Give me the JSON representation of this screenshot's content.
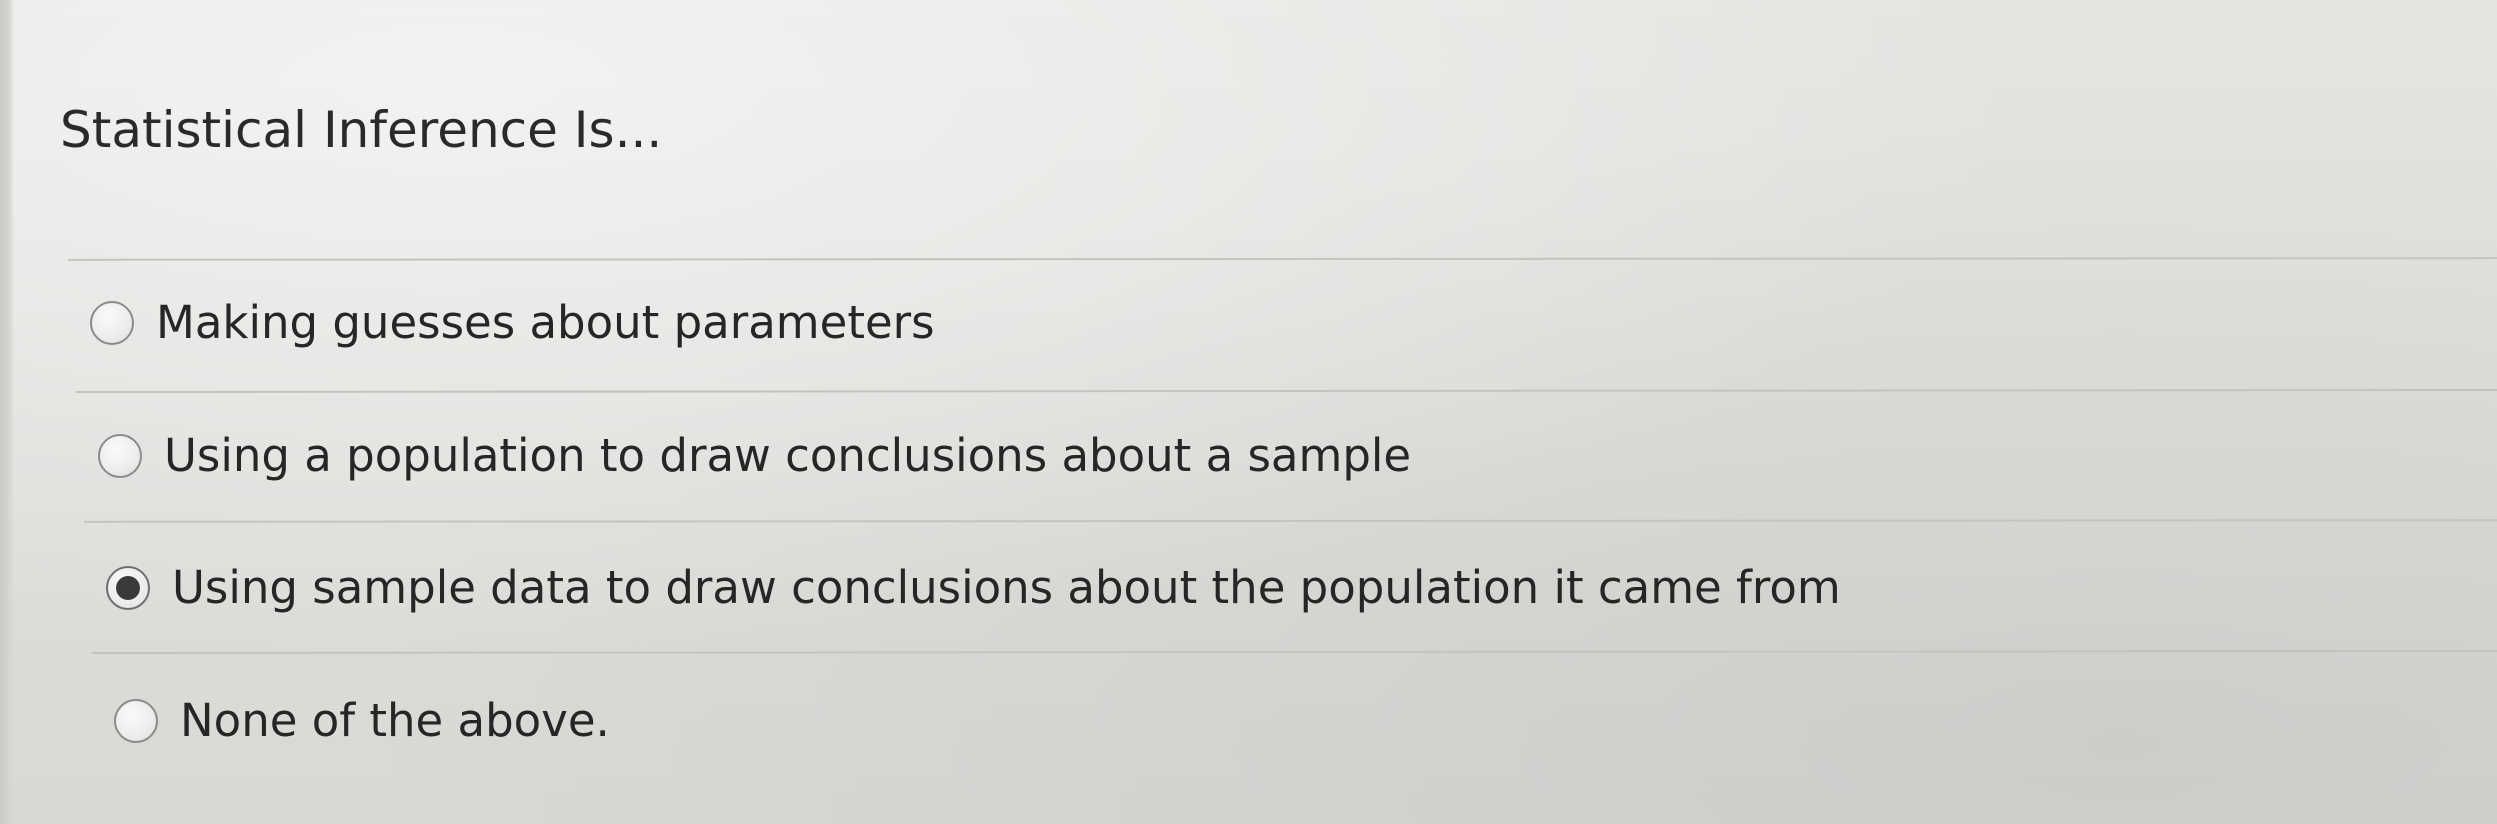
{
  "question": {
    "title": "Statistical Inference Is..."
  },
  "options": [
    {
      "label": "Making guesses about parameters",
      "selected": false
    },
    {
      "label": "Using a population to draw conclusions about a sample",
      "selected": false
    },
    {
      "label": "Using sample data to draw conclusions about the population it came from",
      "selected": true
    },
    {
      "label": "None of the above.",
      "selected": false
    }
  ],
  "colors": {
    "background": "#e0e0dd",
    "text": "#262626",
    "divider": "#c3c3c0",
    "radio_border": "#8b8b8b",
    "radio_selected_dot": "#3a3a3a"
  },
  "icons": {
    "unselected": "radio-unchecked-icon",
    "selected": "radio-checked-icon"
  }
}
